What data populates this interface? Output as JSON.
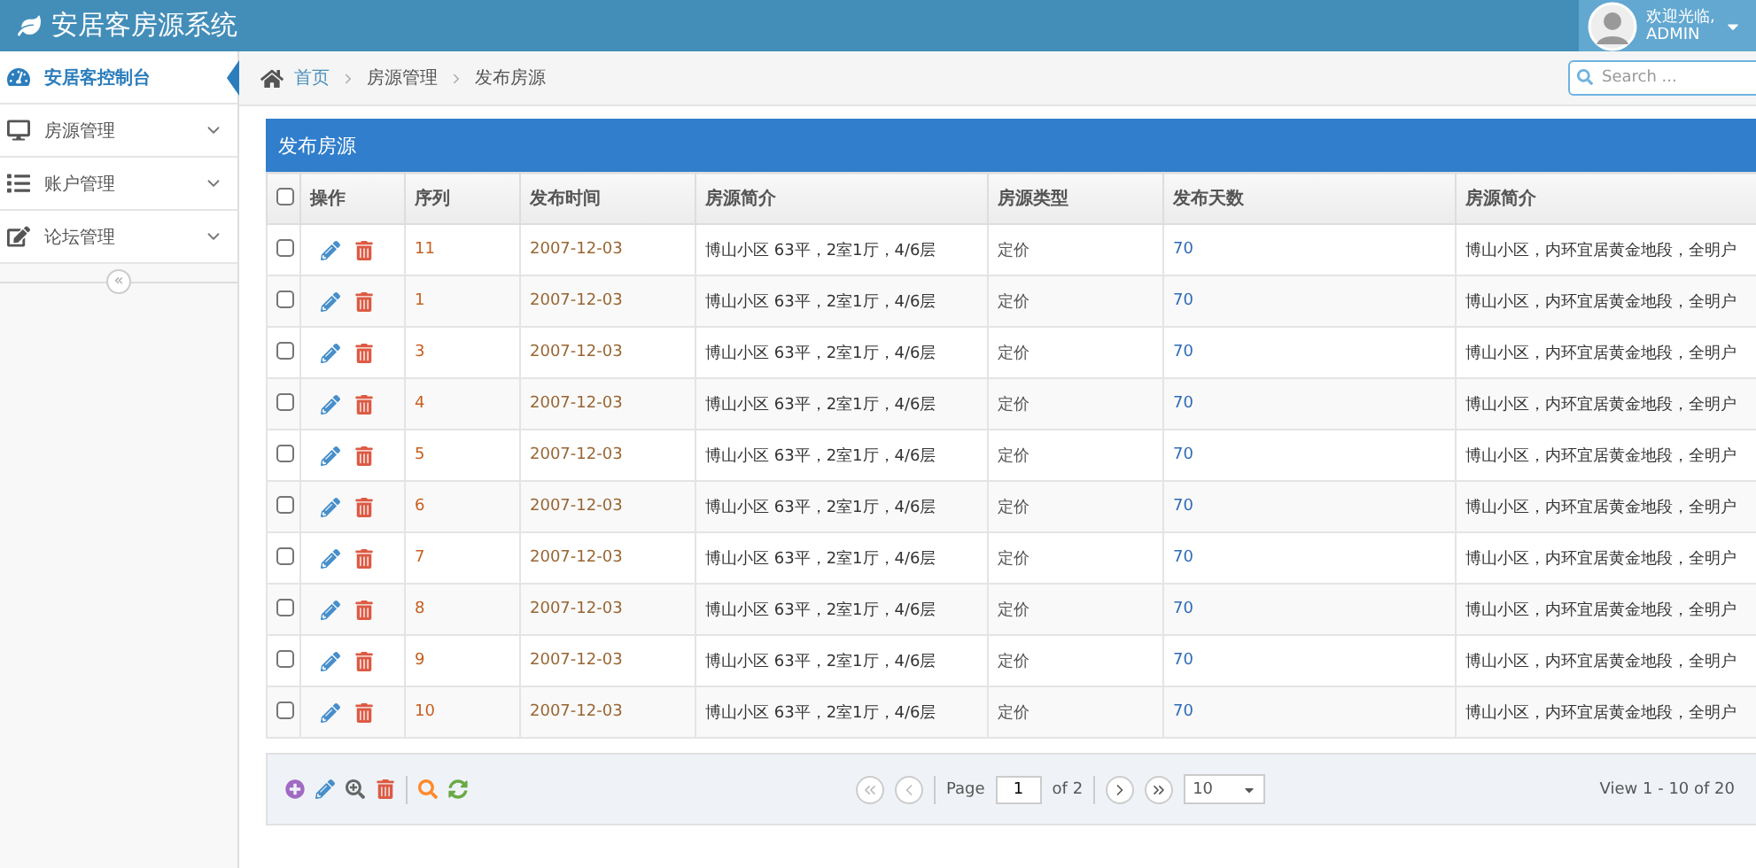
{
  "header": {
    "title": "安居客房源系统",
    "welcome": "欢迎光临,",
    "user": "ADMIN"
  },
  "sidebar": {
    "items": [
      {
        "label": "安居客控制台",
        "selected": true,
        "has_children": false
      },
      {
        "label": "房源管理",
        "selected": false,
        "has_children": true
      },
      {
        "label": "账户管理",
        "selected": false,
        "has_children": true
      },
      {
        "label": "论坛管理",
        "selected": false,
        "has_children": true
      }
    ],
    "collapse": "«"
  },
  "breadcrumb": [
    "首页",
    "房源管理",
    "发布房源"
  ],
  "search": {
    "placeholder": "Search ..."
  },
  "panel": {
    "title": "发布房源"
  },
  "table": {
    "all_checked": false,
    "columns": [
      "",
      "操作",
      "序列",
      "发布时间",
      "房源简介",
      "房源类型",
      "发布天数",
      "房源简介"
    ],
    "rows": [
      {
        "checked": false,
        "cells": [
          "",
          "",
          "11",
          "2007-12-03",
          "博山小区 63平，2室1厅，4/6层",
          "定价",
          "70",
          "博山小区，内环宜居黄金地段，全明户"
        ]
      },
      {
        "checked": false,
        "cells": [
          "",
          "",
          "1",
          "2007-12-03",
          "博山小区 63平，2室1厅，4/6层",
          "定价",
          "70",
          "博山小区，内环宜居黄金地段，全明户"
        ]
      },
      {
        "checked": false,
        "cells": [
          "",
          "",
          "3",
          "2007-12-03",
          "博山小区 63平，2室1厅，4/6层",
          "定价",
          "70",
          "博山小区，内环宜居黄金地段，全明户"
        ]
      },
      {
        "checked": false,
        "cells": [
          "",
          "",
          "4",
          "2007-12-03",
          "博山小区 63平，2室1厅，4/6层",
          "定价",
          "70",
          "博山小区，内环宜居黄金地段，全明户"
        ]
      },
      {
        "checked": false,
        "cells": [
          "",
          "",
          "5",
          "2007-12-03",
          "博山小区 63平，2室1厅，4/6层",
          "定价",
          "70",
          "博山小区，内环宜居黄金地段，全明户"
        ]
      },
      {
        "checked": false,
        "cells": [
          "",
          "",
          "6",
          "2007-12-03",
          "博山小区 63平，2室1厅，4/6层",
          "定价",
          "70",
          "博山小区，内环宜居黄金地段，全明户"
        ]
      },
      {
        "checked": false,
        "cells": [
          "",
          "",
          "7",
          "2007-12-03",
          "博山小区 63平，2室1厅，4/6层",
          "定价",
          "70",
          "博山小区，内环宜居黄金地段，全明户"
        ]
      },
      {
        "checked": false,
        "cells": [
          "",
          "",
          "8",
          "2007-12-03",
          "博山小区 63平，2室1厅，4/6层",
          "定价",
          "70",
          "博山小区，内环宜居黄金地段，全明户"
        ]
      },
      {
        "checked": false,
        "cells": [
          "",
          "",
          "9",
          "2007-12-03",
          "博山小区 63平，2室1厅，4/6层",
          "定价",
          "70",
          "博山小区，内环宜居黄金地段，全明户"
        ]
      },
      {
        "checked": false,
        "cells": [
          "",
          "",
          "10",
          "2007-12-03",
          "博山小区 63平，2室1厅，4/6层",
          "定价",
          "70",
          "博山小区，内环宜居黄金地段，全明户"
        ]
      }
    ]
  },
  "pager": {
    "page_label": "Page",
    "page": "1",
    "of": "of 2",
    "page_size": "10",
    "view": "View 1 - 10 of 20"
  }
}
